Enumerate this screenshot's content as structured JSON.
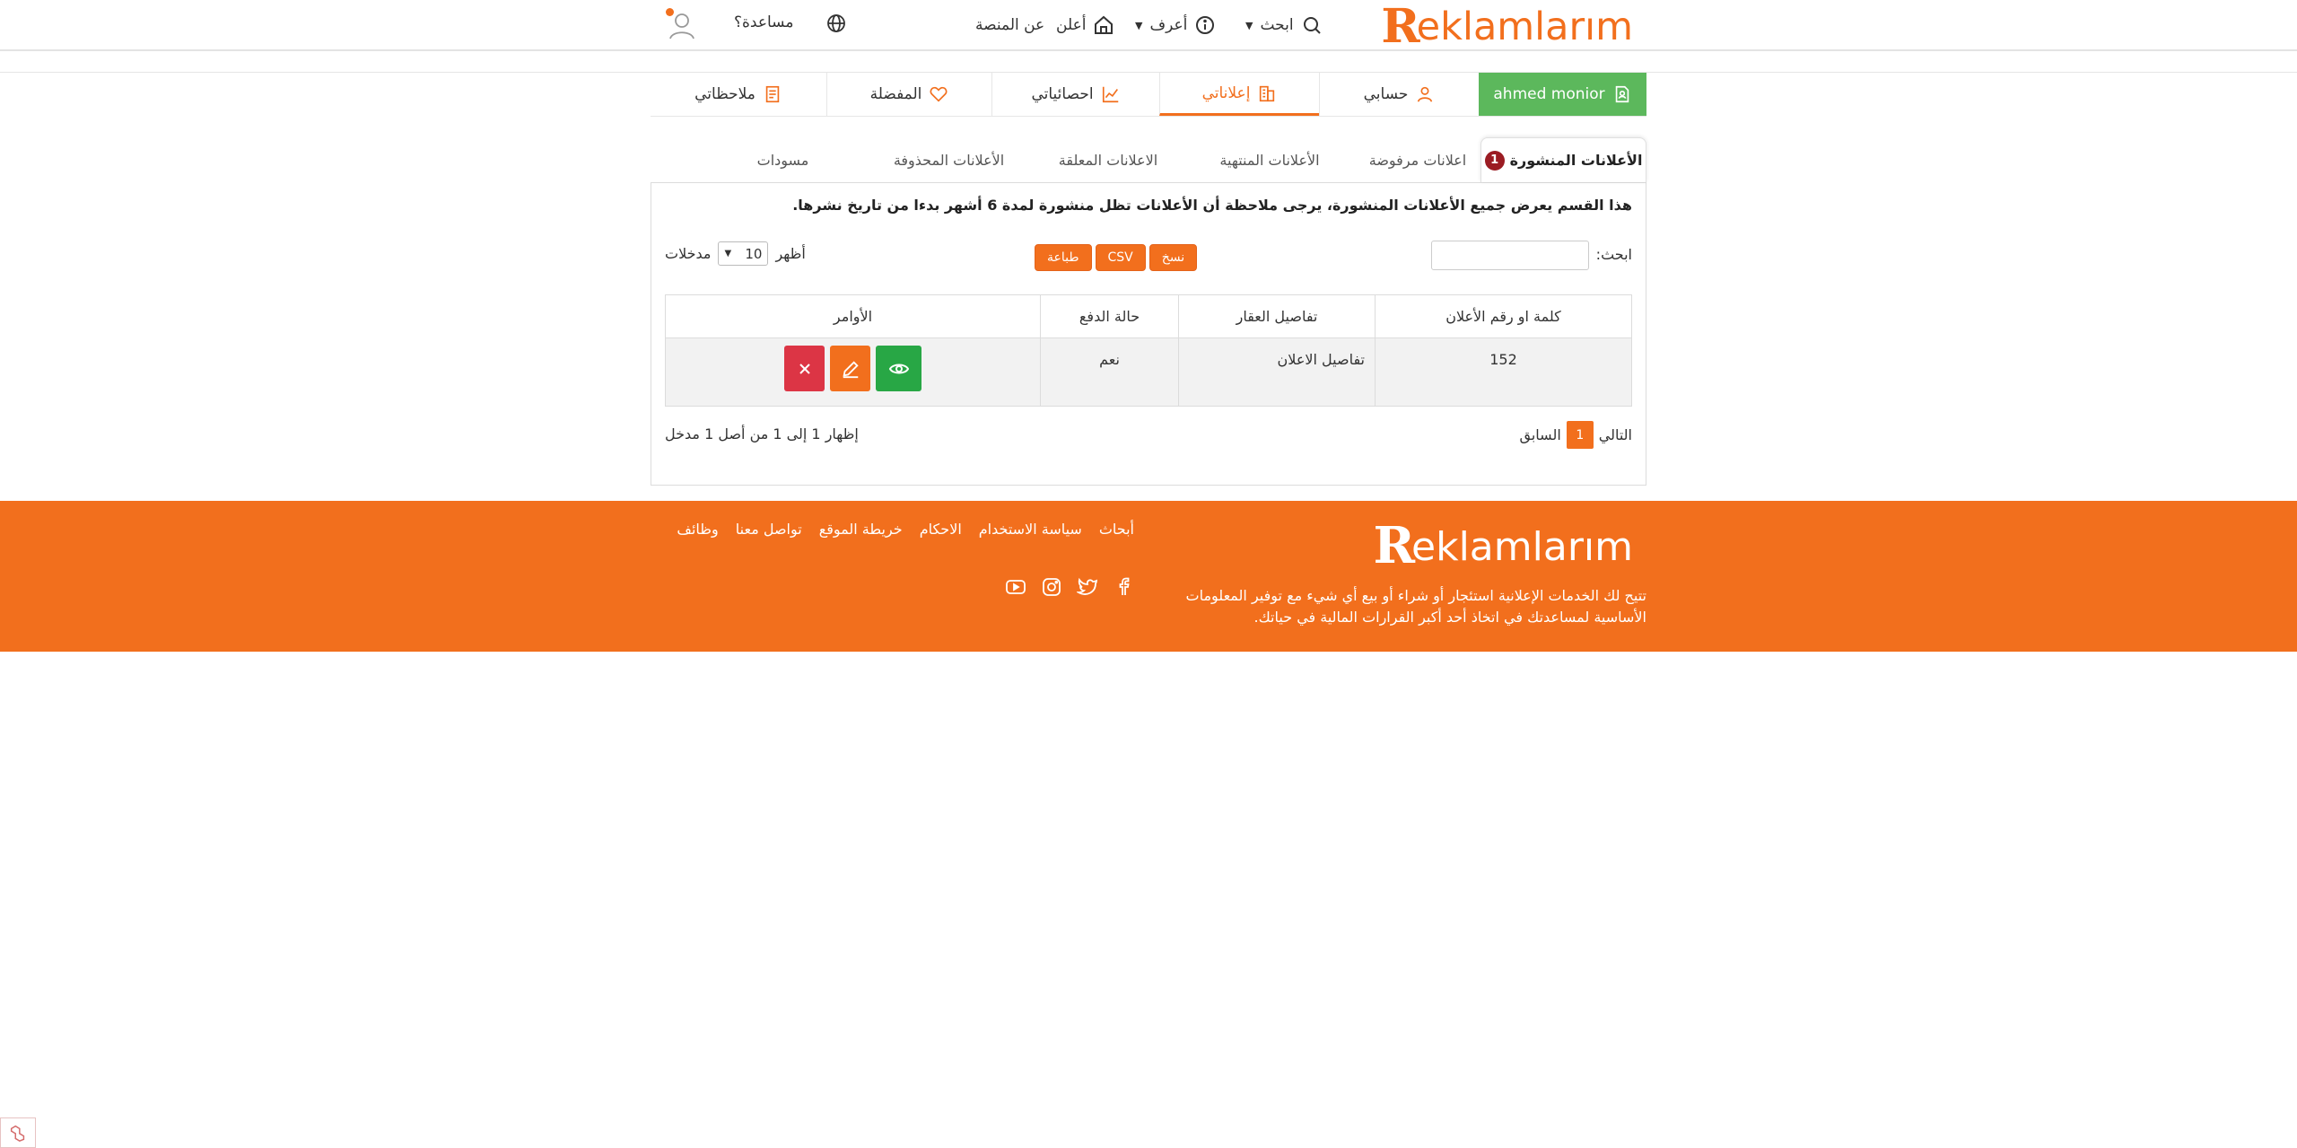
{
  "brand": {
    "logo_letter": "R",
    "logo_rest": "eklamlarım",
    "accent": "#f26f1d"
  },
  "header": {
    "nav": {
      "search": "ابحث",
      "know": "أعرف",
      "advertise": "أعلن",
      "about": "عن المنصة"
    },
    "help": "مساعدة؟"
  },
  "account_tabs": {
    "user": "ahmed monior",
    "account": "حسابي",
    "ads": "إعلاناتي",
    "stats": "احصائياتي",
    "favorites": "المفضلة",
    "notes": "ملاحظاتي"
  },
  "status_tabs": {
    "published": "الأعلانات المنشورة",
    "published_count": "1",
    "rejected": "اعلانات مرفوضة",
    "expired": "الأعلانات المنتهية",
    "pending": "الاعلانات المعلقة",
    "deleted": "الأعلانات المحذوفة",
    "drafts": "مسودات"
  },
  "panel": {
    "notice": "هذا القسم يعرض جميع الأعلانات المنشورة، يرجى ملاحظة أن الأعلانات تظل منشورة لمدة 6 أشهر بدءا من تاريخ نشرها.",
    "search_label": "ابحث:",
    "buttons": {
      "copy": "نسخ",
      "csv": "CSV",
      "print": "طباعة"
    },
    "length": {
      "show": "أظهر",
      "value": "10",
      "entries": "مدخلات"
    },
    "columns": [
      "كلمة او رقم الأعلان",
      "تفاصيل العقار",
      "حالة الدفع",
      "الأوامر"
    ],
    "rows": [
      {
        "id": "152",
        "details": "تفاصيل الاعلان",
        "paid": "نعم"
      }
    ],
    "pager": {
      "prev": "السابق",
      "page": "1",
      "next": "التالي"
    },
    "info": "إظهار 1 إلى 1 من أصل 1 مدخل"
  },
  "footer": {
    "description": "تتيح لك الخدمات الإعلانية استئجار أو شراء أو بيع أي شيء مع توفير المعلومات الأساسية لمساعدتك في اتخاذ أحد أكبر القرارات المالية في حياتك.",
    "links": [
      "وظائف",
      "تواصل معنا",
      "خريطة الموقع",
      "الاحكام",
      "سياسة الاستخدام",
      "أبحاث"
    ],
    "socials": [
      "facebook-icon",
      "twitter-icon",
      "instagram-icon",
      "youtube-icon"
    ]
  }
}
